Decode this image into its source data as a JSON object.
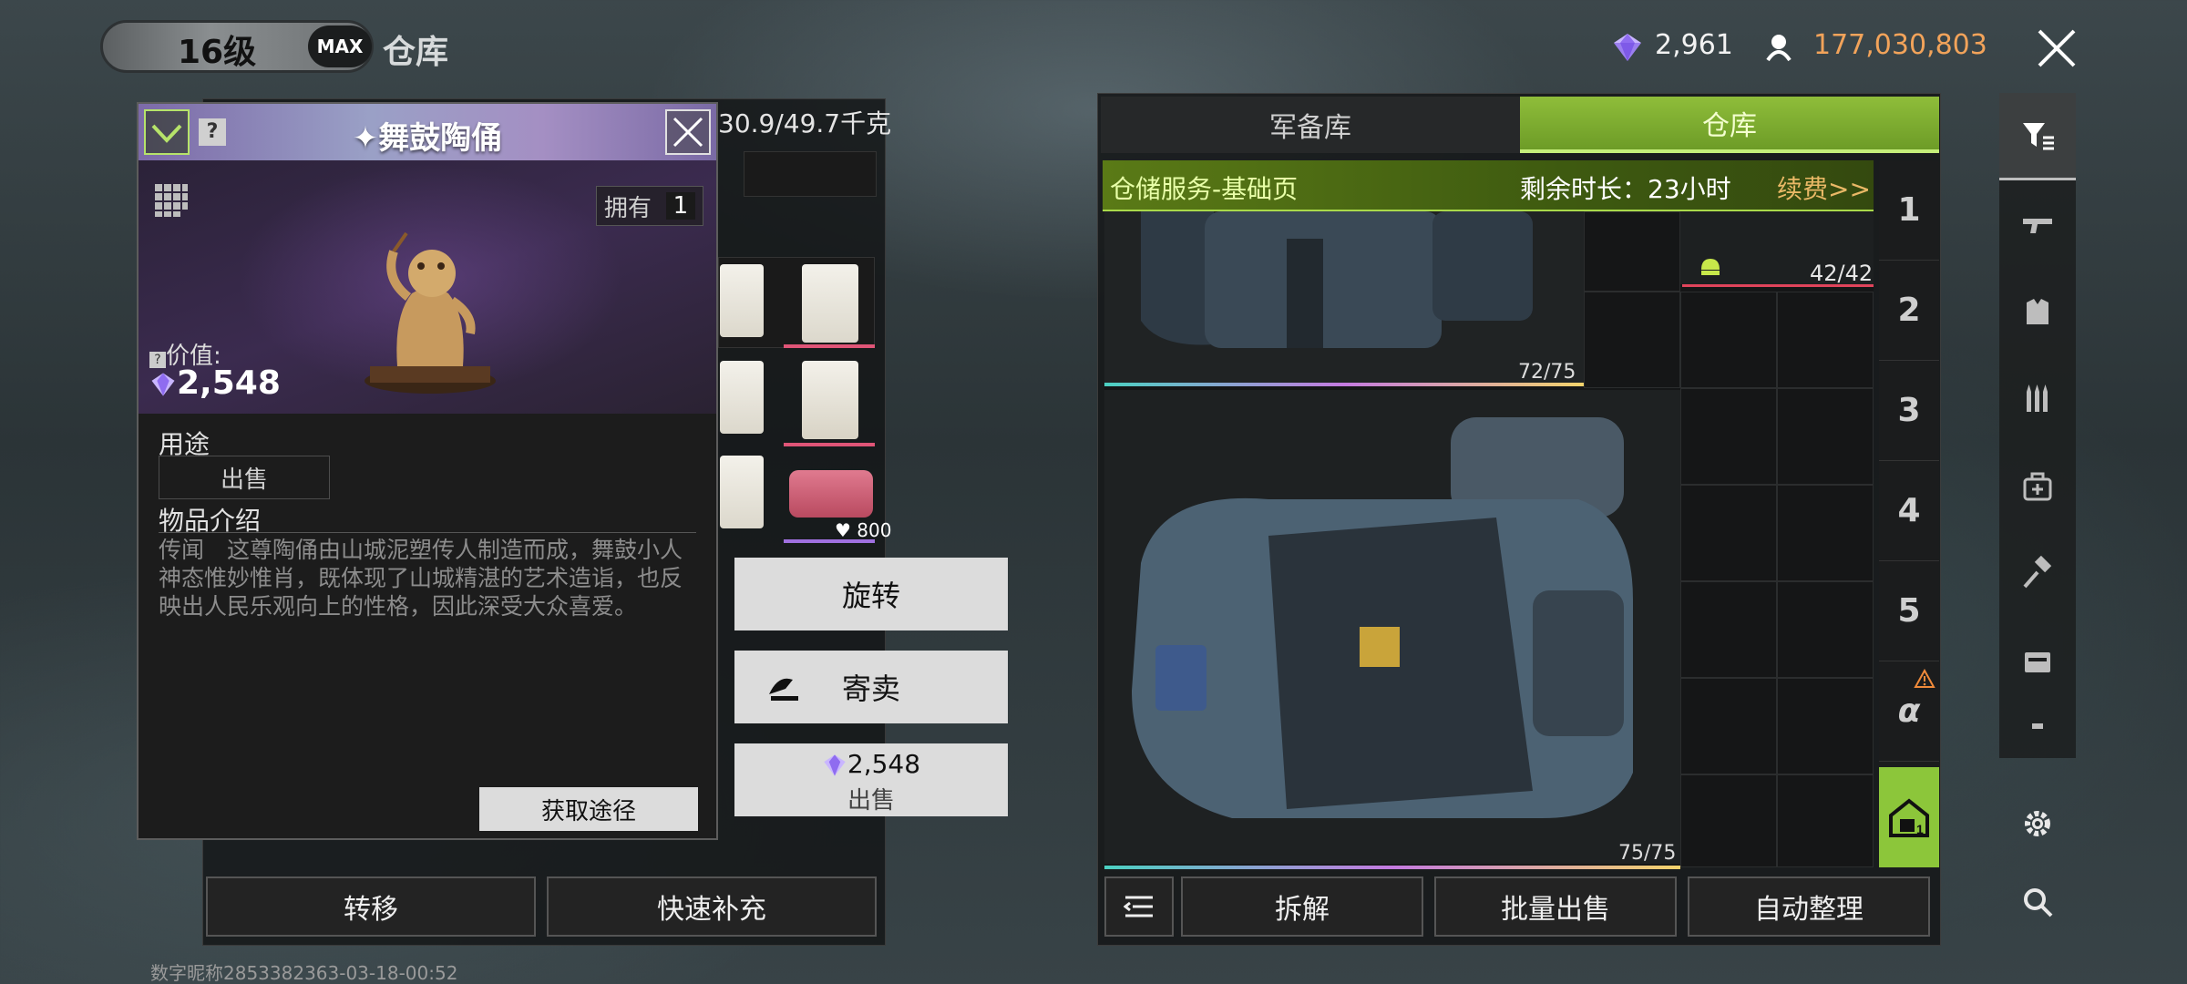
{
  "header": {
    "level": "16级",
    "max_badge": "MAX",
    "title": "仓库",
    "gems": "2,961",
    "coins": "177,030,803"
  },
  "item_detail": {
    "name": "✦舞鼓陶俑",
    "owned_label": "拥有",
    "owned_count": "1",
    "value_label": "价值:",
    "value": "2,548",
    "usage_label": "用途",
    "usage_value": "出售",
    "intro_label": "物品介绍",
    "intro_text": "传闻　这尊陶俑由山城泥塑传人制造而成，舞鼓小人神态惟妙惟肖，既体现了山城精湛的艺术造诣，也反映出人民乐观向上的性格，因此深受大众喜爱。",
    "acquire_button": "获取途径"
  },
  "left_inventory": {
    "weight": "30.9/49.7千克",
    "slot_value": "800",
    "transfer_button": "转移",
    "quick_refill_button": "快速补充"
  },
  "context_menu": {
    "rotate": "旋转",
    "consign": "寄卖",
    "sell_price": "2,548",
    "sell": "出售"
  },
  "warehouse": {
    "tabs": [
      "军备库",
      "仓库"
    ],
    "service_title": "仓储服务-基础页",
    "service_remaining": "剩余时长：23小时",
    "service_renew": "续费>>",
    "bag_top_durability": "72/75",
    "helmet_durability": "42/42",
    "bag_main_durability": "75/75",
    "pages": [
      "1",
      "2",
      "3",
      "4",
      "5",
      "α"
    ],
    "buttons": {
      "dismantle": "拆解",
      "bulk_sell": "批量出售",
      "auto_sort": "自动整理"
    }
  },
  "footer": {
    "watermark": "数字昵称2853382363-03-18-00:52"
  },
  "colors": {
    "accent_green": "#8cc63a",
    "coin_orange": "#f2a35a",
    "renew_gold": "#e9b866"
  }
}
